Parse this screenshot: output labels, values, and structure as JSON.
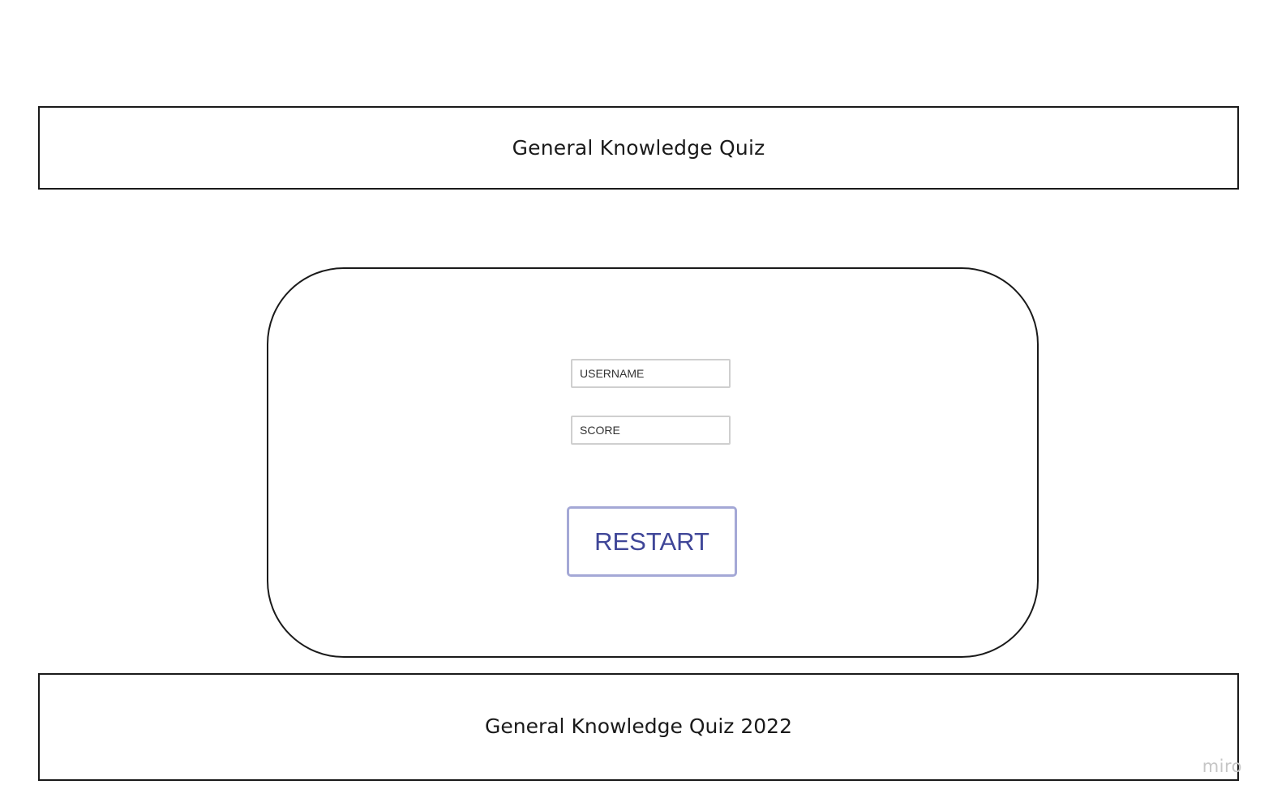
{
  "header": {
    "title": "General Knowledge Quiz"
  },
  "form": {
    "username_placeholder": "USERNAME",
    "score_placeholder": "SCORE",
    "restart_label": "RESTART"
  },
  "footer": {
    "text": "General Knowledge Quiz 2022"
  },
  "watermark": {
    "text": "miro"
  },
  "colors": {
    "border": "#1a1a1a",
    "button_border": "#a4a8d6",
    "button_text": "#3f4698",
    "input_border": "#cfcfcf"
  }
}
